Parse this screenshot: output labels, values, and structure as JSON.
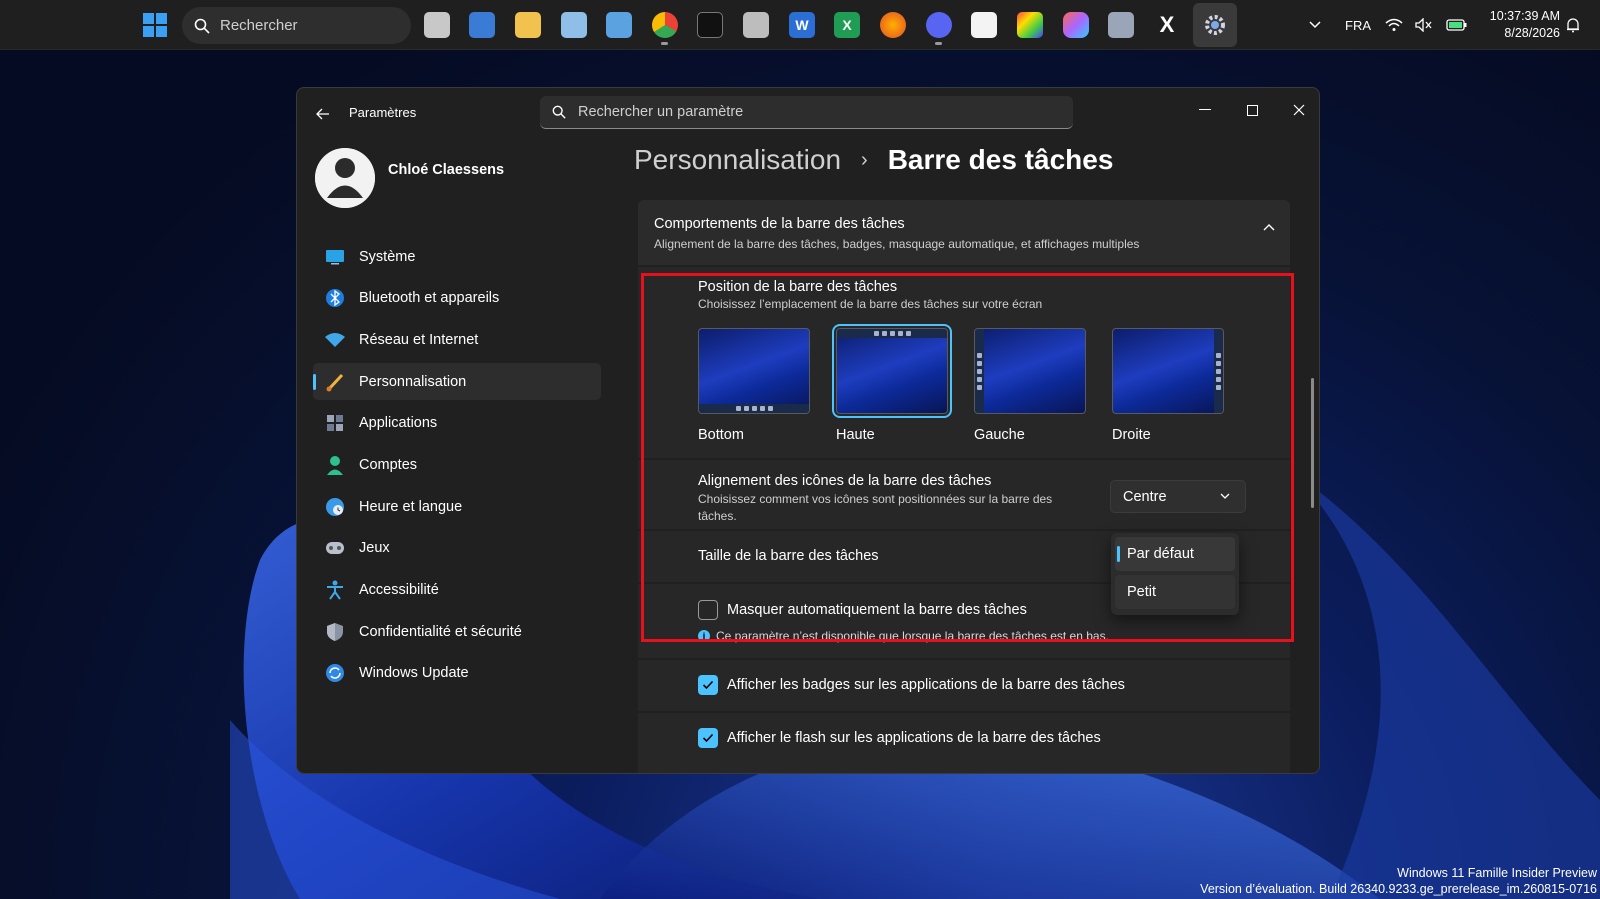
{
  "taskbar": {
    "search_label": "Rechercher",
    "language": "FRA",
    "time": "10:37:39 AM",
    "date": "8/28/2026"
  },
  "window": {
    "app_title": "Paramètres",
    "search_placeholder": "Rechercher un paramètre"
  },
  "profile": {
    "name": "Chloé Claessens"
  },
  "sidebar": {
    "items": [
      {
        "label": "Système",
        "icon": "monitor-icon"
      },
      {
        "label": "Bluetooth et appareils",
        "icon": "bluetooth-icon"
      },
      {
        "label": "Réseau et Internet",
        "icon": "wifi-icon"
      },
      {
        "label": "Personnalisation",
        "icon": "brush-icon",
        "selected": true
      },
      {
        "label": "Applications",
        "icon": "apps-icon"
      },
      {
        "label": "Comptes",
        "icon": "person-icon"
      },
      {
        "label": "Heure et langue",
        "icon": "globe-clock-icon"
      },
      {
        "label": "Jeux",
        "icon": "gamepad-icon"
      },
      {
        "label": "Accessibilité",
        "icon": "accessibility-icon"
      },
      {
        "label": "Confidentialité et sécurité",
        "icon": "shield-icon"
      },
      {
        "label": "Windows Update",
        "icon": "update-icon"
      }
    ]
  },
  "breadcrumb": {
    "parent": "Personnalisation",
    "separator": "›",
    "current": "Barre des tâches"
  },
  "section": {
    "title": "Comportements de la barre des tâches",
    "subtitle": "Alignement de la barre des tâches, badges, masquage automatique, et affichages multiples"
  },
  "position": {
    "title": "Position de la barre des tâches",
    "subtitle": "Choisissez l’emplacement de la barre des tâches sur votre écran",
    "options": [
      {
        "label": "Bottom"
      },
      {
        "label": "Haute",
        "selected": true
      },
      {
        "label": "Gauche"
      },
      {
        "label": "Droite"
      }
    ]
  },
  "alignment": {
    "title": "Alignement des icônes de la barre des tâches",
    "subtitle": "Choisissez comment vos icônes sont positionnées sur la barre des tâches.",
    "value": "Centre"
  },
  "size": {
    "title": "Taille de la barre des tâches",
    "options": [
      "Par défaut",
      "Petit"
    ],
    "selected": "Par défaut"
  },
  "autohide": {
    "label": "Masquer automatiquement la barre des tâches",
    "checked": false,
    "note": "Ce paramètre n’est disponible que lorsque la barre des tâches est en bas."
  },
  "badges": {
    "label": "Afficher les badges sur les applications de la barre des tâches",
    "checked": true
  },
  "flash": {
    "label": "Afficher le flash sur les applications de la barre des tâches",
    "checked": true
  },
  "watermark": {
    "line1": "Windows 11 Famille Insider Preview",
    "line2": "Version d’évaluation. Build 26340.9233.ge_prerelease_im.260815-0716"
  },
  "colors": {
    "accent": "#4cc2ff",
    "highlight": "#e8101c",
    "window_bg": "#202020"
  }
}
